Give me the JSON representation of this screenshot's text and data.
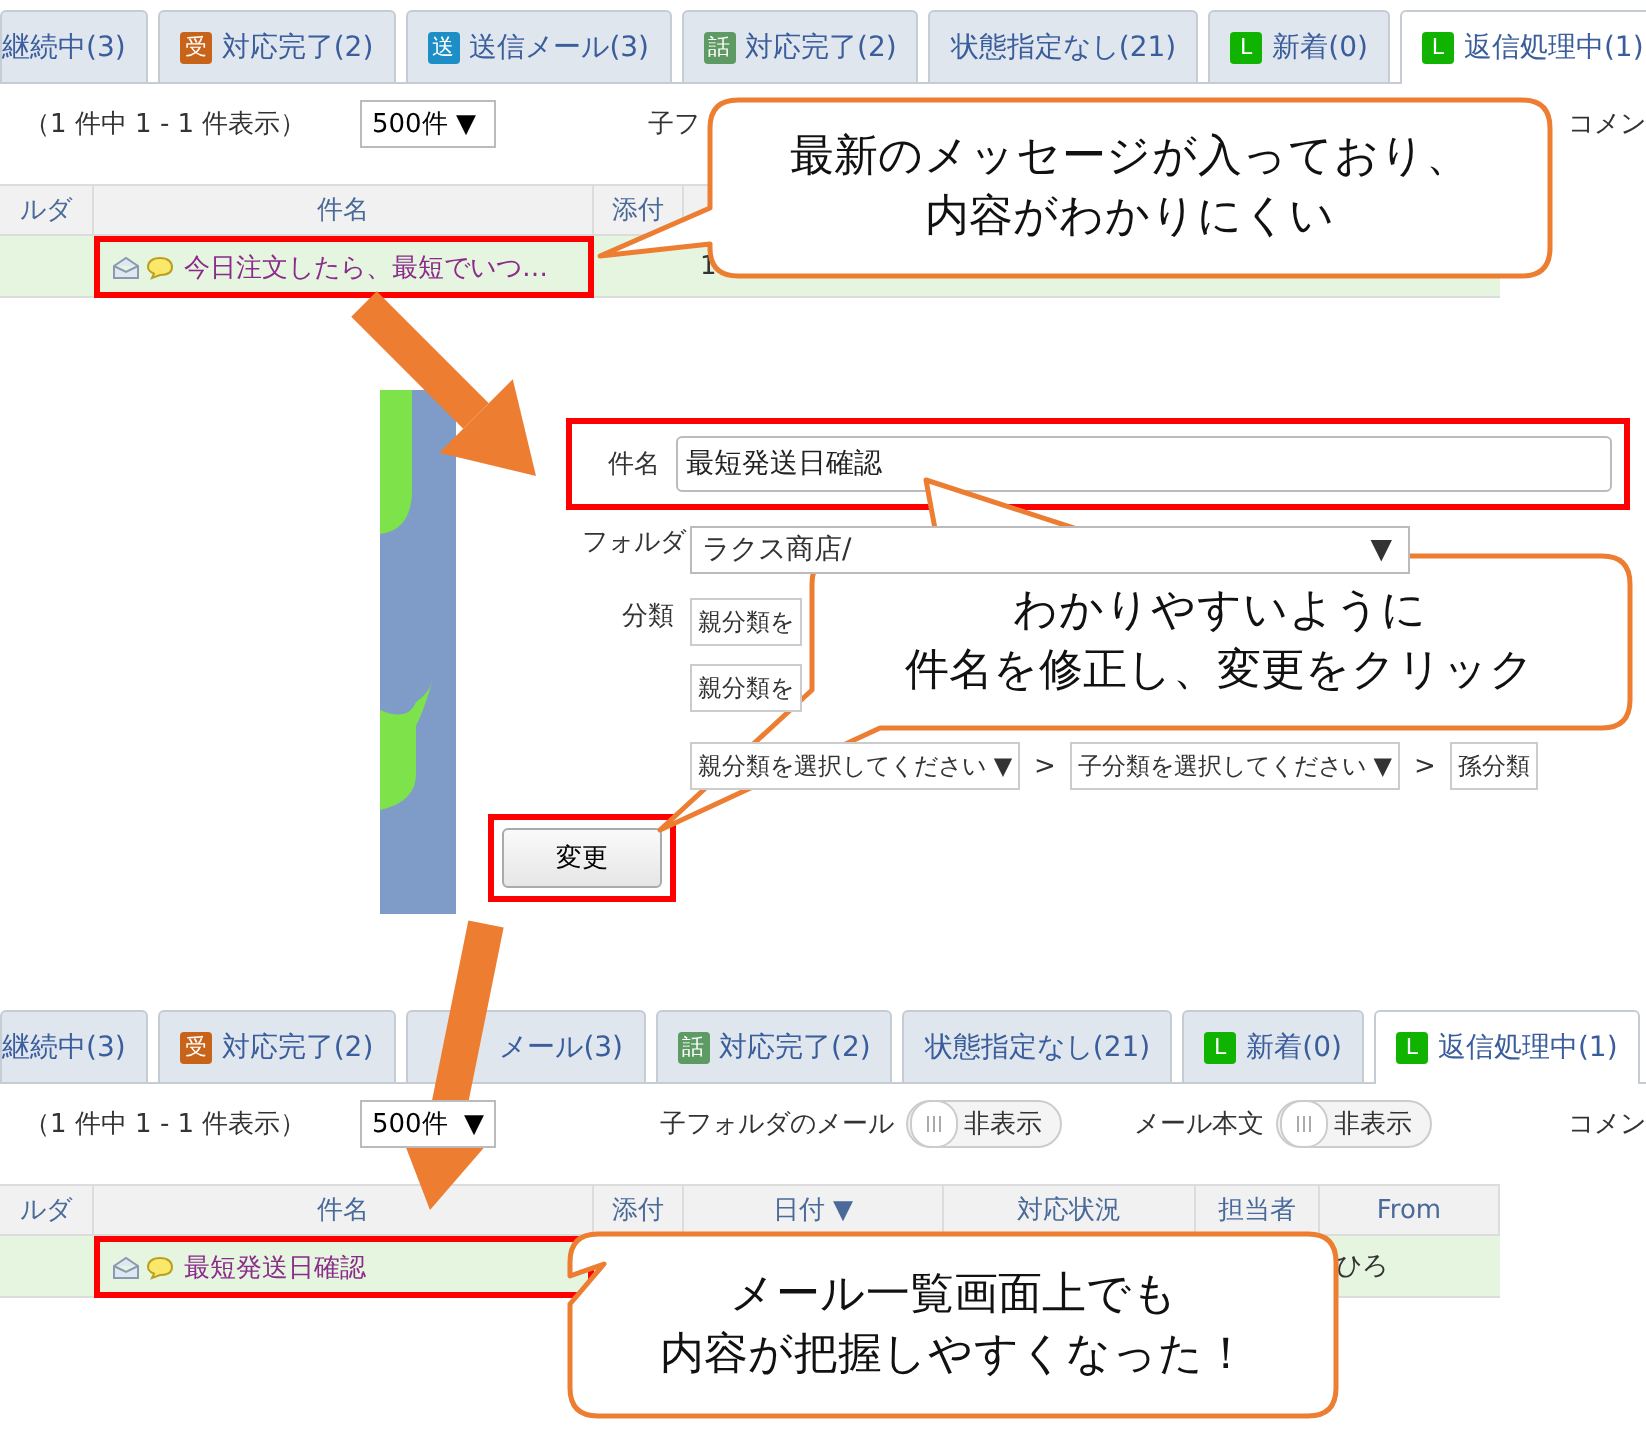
{
  "top_list": {
    "tabs": [
      {
        "label": "継続中(3)",
        "selected": false
      },
      {
        "badge": "受",
        "color": "#c8631a",
        "label": "対応完了(2)",
        "selected": false
      },
      {
        "badge": "送",
        "color": "#1e8fc6",
        "label": "送信メール(3)",
        "selected": false
      },
      {
        "badge": "話",
        "color": "#5e9a63",
        "label": "対応完了(2)",
        "selected": false
      },
      {
        "label": "状態指定なし(21)",
        "selected": false
      },
      {
        "badge": "L",
        "color": "#10b400",
        "label": "新着(0)",
        "selected": false
      },
      {
        "badge": "L",
        "color": "#10b400",
        "label": "返信処理中(1)",
        "selected": true
      }
    ],
    "count": "（1 件中  1 - 1 件表示）",
    "per_page": "500件 ▼",
    "child_folder_label": "子フ",
    "comment_label": "コメン",
    "columns": [
      "ルダ",
      "件名",
      "添付"
    ],
    "row": {
      "subject": "今日注文したら、最短でいつ…",
      "highlighted": true,
      "date": "1"
    }
  },
  "edit_form": {
    "subject": {
      "label": "件名",
      "value": "最短発送日確認",
      "highlighted": true
    },
    "folder": {
      "label": "フォルダ",
      "value": "ラクス商店/",
      "caret": "▼"
    },
    "category": {
      "label": "分類",
      "rows": [
        {
          "items": [
            {
              "kind": "select",
              "text": "親分類を"
            }
          ]
        },
        {
          "items": [
            {
              "kind": "select",
              "text": "親分類を"
            }
          ]
        },
        {
          "items": [
            {
              "kind": "select",
              "text": "親分類を選択してください ▼"
            },
            {
              "kind": "separator",
              "text": ">"
            },
            {
              "kind": "select",
              "text": "子分類を選択してください ▼"
            },
            {
              "kind": "separator",
              "text": ">"
            },
            {
              "kind": "select",
              "text": "孫分類"
            }
          ]
        }
      ]
    },
    "button": {
      "label": "変更",
      "highlighted": true
    }
  },
  "bottom_list": {
    "tabs": [
      {
        "label": "継続中(3)",
        "selected": false
      },
      {
        "badge": "受",
        "color": "#c8631a",
        "label": "対応完了(2)",
        "selected": false
      },
      {
        "label": "メール(3)",
        "selected": false
      },
      {
        "badge": "話",
        "color": "#5e9a63",
        "label": "対応完了(2)",
        "selected": false
      },
      {
        "label": "状態指定なし(21)",
        "selected": false
      },
      {
        "badge": "L",
        "color": "#10b400",
        "label": "新着(0)",
        "selected": false
      },
      {
        "badge": "L",
        "color": "#10b400",
        "label": "返信処理中(1)",
        "selected": true
      }
    ],
    "count": "（1 件中  1 - 1 件表示）",
    "per_page": "500件",
    "per_page_caret": "▼",
    "toggles": [
      {
        "label": "子フォルダのメール",
        "state": "非表示",
        "on": false
      },
      {
        "label": "メール本文",
        "state": "非表示",
        "on": false
      }
    ],
    "comment_label": "コメン",
    "columns": [
      "ルダ",
      "件名",
      "添付",
      "日付 ▼",
      "対応状況",
      "担当者",
      "From"
    ],
    "row": {
      "subject": "最短発送日確認",
      "highlighted": true,
      "from": "ひろ"
    }
  },
  "callouts": [
    {
      "lines": [
        "最新のメッセージが入っており、",
        "内容がわかりにくい"
      ]
    },
    {
      "lines": [
        "わかりやすいように",
        "件名を修正し、変更をクリック"
      ]
    },
    {
      "lines": [
        "メール一覧画面上でも",
        "内容が把握しやすくなった！"
      ]
    }
  ]
}
